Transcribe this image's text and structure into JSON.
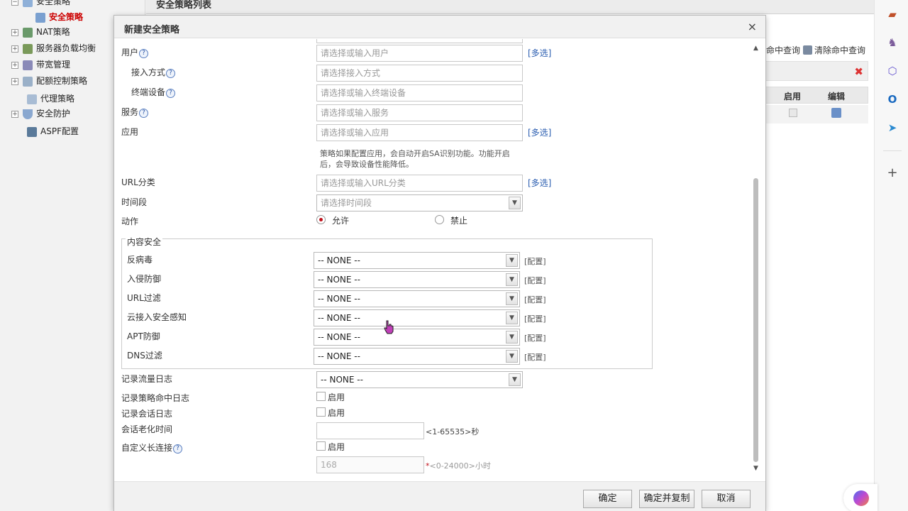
{
  "left_nav": {
    "items": [
      {
        "label": "安全策略",
        "icon": "policy-folder-icon",
        "expand": "−"
      },
      {
        "label": "安全策略",
        "icon": "policy-page-icon",
        "active": true
      },
      {
        "label": "NAT策略",
        "icon": "nat-icon",
        "expand": "+"
      },
      {
        "label": "服务器负载均衡",
        "icon": "server-lb-icon",
        "expand": "+"
      },
      {
        "label": "带宽管理",
        "icon": "bandwidth-icon",
        "expand": "+"
      },
      {
        "label": "配额控制策略",
        "icon": "quota-icon",
        "expand": "+"
      },
      {
        "label": "代理策略",
        "icon": "proxy-icon"
      },
      {
        "label": "安全防护",
        "icon": "shield-icon",
        "expand": "+"
      },
      {
        "label": "ASPF配置",
        "icon": "aspf-icon"
      }
    ]
  },
  "background_page": {
    "title": "安全策略列表",
    "hit_query": "命中查询",
    "clear_hit_query": "清除命中查询",
    "columns": [
      "启用",
      "编辑"
    ]
  },
  "dialog": {
    "title": "新建安全策略",
    "close": "×",
    "fields": {
      "user": {
        "label": "用户",
        "placeholder": "请选择或输入用户",
        "multi": "[多选]"
      },
      "access_mode": {
        "label": "接入方式",
        "placeholder": "请选择接入方式"
      },
      "terminal_device": {
        "label": "终端设备",
        "placeholder": "请选择或输入终端设备"
      },
      "service": {
        "label": "服务",
        "placeholder": "请选择或输入服务"
      },
      "application": {
        "label": "应用",
        "placeholder": "请选择或输入应用",
        "multi": "[多选]",
        "note_line1": "策略如果配置应用，会自动开启SA识别功能。功能开启",
        "note_line2": "后，会导致设备性能降低。"
      },
      "url_category": {
        "label": "URL分类",
        "placeholder": "请选择或输入URL分类",
        "multi": "[多选]"
      },
      "time_range": {
        "label": "时间段",
        "placeholder": "请选择时间段"
      },
      "action": {
        "label": "动作",
        "allow": "允许",
        "deny": "禁止",
        "selected": "allow"
      }
    },
    "content_security": {
      "legend": "内容安全",
      "rows": [
        {
          "label": "反病毒",
          "value": "-- NONE --",
          "config": "[配置]"
        },
        {
          "label": "入侵防御",
          "value": "-- NONE --",
          "config": "[配置]"
        },
        {
          "label": "URL过滤",
          "value": "-- NONE --",
          "config": "[配置]"
        },
        {
          "label": "云接入安全感知",
          "value": "-- NONE --",
          "config": "[配置]"
        },
        {
          "label": "APT防御",
          "value": "-- NONE --",
          "config": "[配置]"
        },
        {
          "label": "DNS过滤",
          "value": "-- NONE --",
          "config": "[配置]"
        }
      ]
    },
    "logging": {
      "traffic_log": {
        "label": "记录流量日志",
        "value": "-- NONE --"
      },
      "hit_log": {
        "label": "记录策略命中日志",
        "check": "启用"
      },
      "session_log": {
        "label": "记录会话日志",
        "check": "启用"
      },
      "session_aging": {
        "label": "会话老化时间",
        "value": "",
        "range": "<1-65535>秒"
      },
      "long_connection": {
        "label": "自定义长连接",
        "check": "启用"
      },
      "long_conn_hours": {
        "value": "168",
        "range_star": "*",
        "range": "<0-24000>小时"
      }
    },
    "buttons": {
      "ok": "确定",
      "ok_copy": "确定并复制",
      "cancel": "取消"
    }
  },
  "colors": {
    "active_nav": "#cc0000",
    "link": "#2a5db0",
    "radio_on": "#c0101a"
  }
}
